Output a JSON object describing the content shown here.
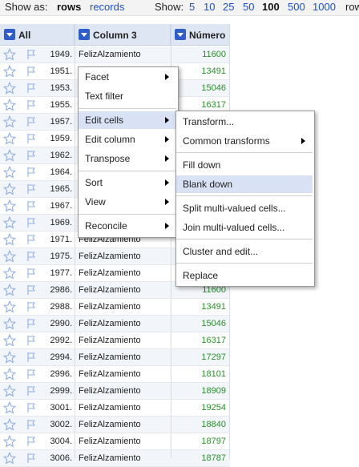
{
  "toolbar": {
    "show_as_label": "Show as:",
    "mode_rows": "rows",
    "mode_records": "records",
    "show_label": "Show:",
    "page_sizes": [
      "5",
      "10",
      "25",
      "50",
      "100",
      "500",
      "1000"
    ],
    "selected_page_size": "100",
    "trailing": "row"
  },
  "columns": {
    "all": "All",
    "col3": "Column 3",
    "numero": "Número"
  },
  "rows": [
    {
      "idx": "1949.",
      "c3": "FelizAlzamiento",
      "num": "11600"
    },
    {
      "idx": "1951.",
      "c3": "",
      "num": "13491"
    },
    {
      "idx": "1953.",
      "c3": "",
      "num": "15046"
    },
    {
      "idx": "1955.",
      "c3": "",
      "num": "16317"
    },
    {
      "idx": "1957.",
      "c3": "",
      "num": ""
    },
    {
      "idx": "1959.",
      "c3": "",
      "num": ""
    },
    {
      "idx": "1962.",
      "c3": "",
      "num": ""
    },
    {
      "idx": "1964.",
      "c3": "",
      "num": ""
    },
    {
      "idx": "1965.",
      "c3": "",
      "num": ""
    },
    {
      "idx": "1967.",
      "c3": "",
      "num": ""
    },
    {
      "idx": "1969.",
      "c3": "",
      "num": ""
    },
    {
      "idx": "1971.",
      "c3": "FelizAlzamiento",
      "num": ""
    },
    {
      "idx": "1975.",
      "c3": "FelizAlzamiento",
      "num": ""
    },
    {
      "idx": "1977.",
      "c3": "FelizAlzamiento",
      "num": ""
    },
    {
      "idx": "2986.",
      "c3": "FelizAlzamiento",
      "num": "11600"
    },
    {
      "idx": "2988.",
      "c3": "FelizAlzamiento",
      "num": "13491"
    },
    {
      "idx": "2990.",
      "c3": "FelizAlzamiento",
      "num": "15046"
    },
    {
      "idx": "2992.",
      "c3": "FelizAlzamiento",
      "num": "16317"
    },
    {
      "idx": "2994.",
      "c3": "FelizAlzamiento",
      "num": "17297"
    },
    {
      "idx": "2996.",
      "c3": "FelizAlzamiento",
      "num": "18101"
    },
    {
      "idx": "2999.",
      "c3": "FelizAlzamiento",
      "num": "18909"
    },
    {
      "idx": "3001.",
      "c3": "FelizAlzamiento",
      "num": "19254"
    },
    {
      "idx": "3002.",
      "c3": "FelizAlzamiento",
      "num": "18840"
    },
    {
      "idx": "3004.",
      "c3": "FelizAlzamiento",
      "num": "18797"
    },
    {
      "idx": "3006.",
      "c3": "FelizAlzamiento",
      "num": "18787"
    }
  ],
  "column_menu": {
    "items": [
      "Facet",
      "Text filter",
      "Edit cells",
      "Edit column",
      "Transpose",
      "Sort",
      "View",
      "Reconcile"
    ],
    "active": "Edit cells"
  },
  "edit_cells_submenu": {
    "items": [
      "Transform...",
      "Common transforms",
      "Fill down",
      "Blank down",
      "Split multi-valued cells...",
      "Join multi-valued cells...",
      "Cluster and edit...",
      "Replace"
    ],
    "active": "Blank down"
  },
  "icons": {
    "star": "star-outline-icon",
    "flag": "flag-outline-icon",
    "dropdown": "column-dropdown-icon",
    "submenu_arrow": "submenu-arrow-icon"
  },
  "colors": {
    "link": "#1a52c8",
    "number": "#2e8b2e",
    "header_bg": "#dfe6f3",
    "dropdown_button": "#2f5ecc",
    "menu_highlight": "#d9e2f4"
  }
}
